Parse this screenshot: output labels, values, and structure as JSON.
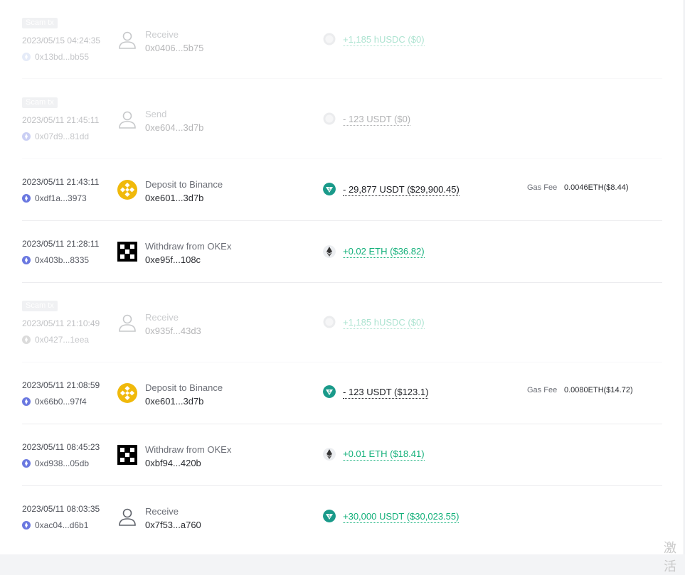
{
  "colors": {
    "positive": "#13b07a",
    "negative": "#1d1f24",
    "usdt_teal": "#1a9a8a",
    "binance_yellow": "#f0b90b",
    "okex_black": "#000000",
    "scam_badge": "#d7d9dd"
  },
  "transactions": [
    {
      "scam": true,
      "scam_label": "Scam tx",
      "date": "2023/05/15 04:24:35",
      "hash": "0x13bd...bb55",
      "chain_icon": "arbitrum-chain-icon",
      "counterparty_icon": "person-icon",
      "action": "Receive",
      "address": "0x0406...5b75",
      "token_icon": "unknown-token-icon",
      "amount": "+1,185 hUSDC ($0)",
      "direction": "in",
      "gas_label": "",
      "gas_value": ""
    },
    {
      "scam": true,
      "scam_label": "Scam tx",
      "date": "2023/05/11 21:45:11",
      "hash": "0x07d9...81dd",
      "chain_icon": "ethereum-chain-icon",
      "counterparty_icon": "person-icon",
      "action": "Send",
      "address": "0xe604...3d7b",
      "token_icon": "unknown-token-icon",
      "amount": "- 123 USDT ($0)",
      "direction": "out",
      "gas_label": "",
      "gas_value": ""
    },
    {
      "scam": false,
      "scam_label": "",
      "date": "2023/05/11 21:43:11",
      "hash": "0xdf1a...3973",
      "chain_icon": "ethereum-chain-icon",
      "counterparty_icon": "binance-logo-icon",
      "action": "Deposit to Binance",
      "address": "0xe601...3d7b",
      "token_icon": "usdt-token-icon",
      "amount": "- 29,877 USDT ($29,900.45)",
      "direction": "out",
      "gas_label": "Gas Fee",
      "gas_value": "0.0046ETH($8.44)"
    },
    {
      "scam": false,
      "scam_label": "",
      "date": "2023/05/11 21:28:11",
      "hash": "0x403b...8335",
      "chain_icon": "ethereum-chain-icon",
      "counterparty_icon": "okex-logo-icon",
      "action": "Withdraw from OKEx",
      "address": "0xe95f...108c",
      "token_icon": "eth-token-icon",
      "amount": "+0.02 ETH ($36.82)",
      "direction": "in",
      "gas_label": "",
      "gas_value": ""
    },
    {
      "scam": true,
      "scam_label": "Scam tx",
      "date": "2023/05/11 21:10:49",
      "hash": "0x0427...1eea",
      "chain_icon": "gray-chain-icon",
      "counterparty_icon": "person-icon",
      "action": "Receive",
      "address": "0x935f...43d3",
      "token_icon": "unknown-token-icon",
      "amount": "+1,185 hUSDC ($0)",
      "direction": "in",
      "gas_label": "",
      "gas_value": ""
    },
    {
      "scam": false,
      "scam_label": "",
      "date": "2023/05/11 21:08:59",
      "hash": "0x66b0...97f4",
      "chain_icon": "ethereum-chain-icon",
      "counterparty_icon": "binance-logo-icon",
      "action": "Deposit to Binance",
      "address": "0xe601...3d7b",
      "token_icon": "usdt-token-icon",
      "amount": "- 123 USDT ($123.1)",
      "direction": "out",
      "gas_label": "Gas Fee",
      "gas_value": "0.0080ETH($14.72)"
    },
    {
      "scam": false,
      "scam_label": "",
      "date": "2023/05/11 08:45:23",
      "hash": "0xd938...05db",
      "chain_icon": "ethereum-chain-icon",
      "counterparty_icon": "okex-logo-icon",
      "action": "Withdraw from OKEx",
      "address": "0xbf94...420b",
      "token_icon": "eth-token-icon",
      "amount": "+0.01 ETH ($18.41)",
      "direction": "in",
      "gas_label": "",
      "gas_value": ""
    },
    {
      "scam": false,
      "scam_label": "",
      "date": "2023/05/11 08:03:35",
      "hash": "0xac04...d6b1",
      "chain_icon": "ethereum-chain-icon",
      "counterparty_icon": "person-icon",
      "action": "Receive",
      "address": "0x7f53...a760",
      "token_icon": "usdt-token-icon",
      "amount": "+30,000 USDT ($30,023.55)",
      "direction": "in",
      "gas_label": "",
      "gas_value": ""
    }
  ],
  "watermark": "激活"
}
